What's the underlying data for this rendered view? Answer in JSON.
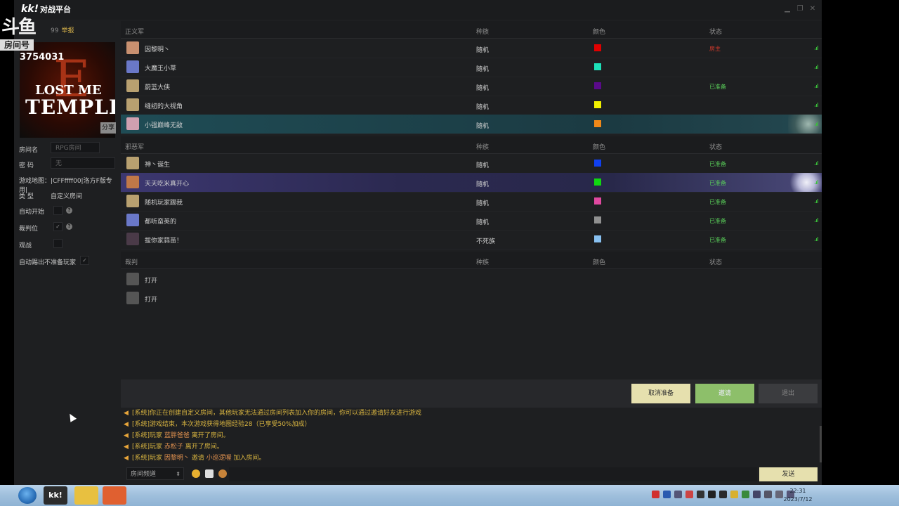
{
  "app": {
    "title_logo": "kk!",
    "title_text": "对战平台",
    "window_controls": [
      "minimize-icon",
      "restore-icon",
      "close-icon"
    ]
  },
  "watermark": {
    "brand": "斗鱼",
    "room_label": "房间号",
    "room_number": "3754031"
  },
  "left": {
    "room_id_suffix": "99",
    "report": "举报",
    "map_thumb": {
      "letter": "E",
      "line1": "LOST ME",
      "line2": "TEMPLE"
    },
    "room_name_label": "房间名",
    "room_name_placeholder": "RPG房间",
    "share": "分享",
    "password_label": "密  码",
    "password_value": "无",
    "map_label": "游戏地图：",
    "map_value": "|CFFffff00|洛方F版专用|",
    "type_label": "类  型",
    "type_value": "自定义房间",
    "auto_start": "自动开始",
    "referee": "裁判位",
    "spectate": "观战",
    "auto_kick": "自动踢出不准备玩家"
  },
  "headers": {
    "race": "种族",
    "color": "颜色",
    "status": "状态"
  },
  "teams": [
    {
      "name": "正义军",
      "players": [
        {
          "name": "因黎明丶",
          "race": "随机",
          "color": "#e00000",
          "status": "房主",
          "status_color": "#d83a2a",
          "avatar": "#c89070"
        },
        {
          "name": "大魔王小草",
          "race": "随机",
          "color": "#1de0b8",
          "status": "",
          "status_color": "#5ad05a",
          "avatar": "#6a78c8"
        },
        {
          "name": "蔚蓝大侠",
          "race": "随机",
          "color": "#5a0a8a",
          "status": "已准备",
          "status_color": "#5ad05a",
          "avatar": "#b8a070"
        },
        {
          "name": "缝纫的大视角",
          "race": "随机",
          "color": "#f0f000",
          "status": "",
          "status_color": "#5ad05a",
          "avatar": "#b8a070"
        },
        {
          "name": "小强巅峰无敌",
          "race": "随机",
          "color": "#f08818",
          "status": "",
          "status_color": "#5ad05a",
          "avatar": "#d0a0b0"
        }
      ]
    },
    {
      "name": "邪恶军",
      "players": [
        {
          "name": "神丶诞生",
          "race": "随机",
          "color": "#1040f0",
          "status": "已准备",
          "status_color": "#5ad05a",
          "avatar": "#b8a070"
        },
        {
          "name": "天天吃米真开心",
          "race": "随机",
          "color": "#10d810",
          "status": "已准备",
          "status_color": "#5ad05a",
          "avatar": "#c07848"
        },
        {
          "name": "随机玩家踢我",
          "race": "随机",
          "color": "#e048a0",
          "status": "已准备",
          "status_color": "#5ad05a",
          "avatar": "#b8a070"
        },
        {
          "name": "都听蛮英的",
          "race": "随机",
          "color": "#909090",
          "status": "已准备",
          "status_color": "#5ad05a",
          "avatar": "#6a78c8"
        },
        {
          "name": "拔你家蒜苗！",
          "race": "不死族",
          "color": "#88c0f0",
          "status": "已准备",
          "status_color": "#5ad05a",
          "avatar": "#4a3a48"
        }
      ]
    }
  ],
  "referee_section": {
    "name": "裁判",
    "slots": [
      {
        "label": "打开"
      },
      {
        "label": "打开"
      }
    ]
  },
  "actions": {
    "ready": "取消准备",
    "invite": "邀请",
    "exit": "退出"
  },
  "chat": {
    "messages": [
      {
        "text": "[系统]你正在创建自定义房间，其他玩家无法通过房间列表加入你的房间，你可以通过邀请好友进行游戏"
      },
      {
        "text": "[系统]游戏结束，本次游戏获得地图经验28（已享受50%加成）"
      },
      {
        "prefix": "[系统]玩家 ",
        "name": "蓝胖爸爸",
        "suffix": " 离开了房间。"
      },
      {
        "prefix": "[系统]玩家 ",
        "name": "赤松子",
        "suffix": " 离开了房间。"
      },
      {
        "prefix": "[系统]玩家 ",
        "name": "因黎明丶",
        "mid": " 邀请 ",
        "name2": "小巡逻喔",
        "suffix": " 加入房间。"
      }
    ],
    "channel": "房间频道",
    "send": "发送"
  },
  "taskbar": {
    "time": "22:31",
    "date": "2023/7/12"
  }
}
